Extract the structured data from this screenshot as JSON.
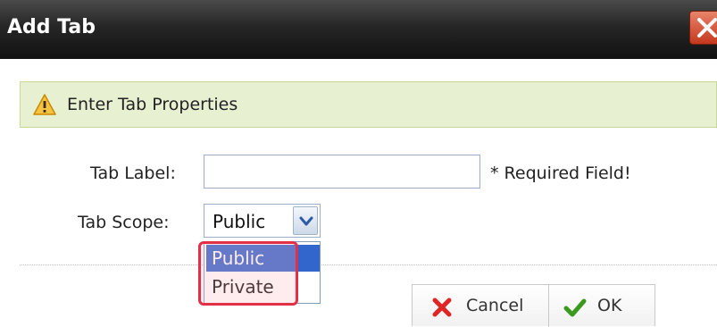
{
  "dialog": {
    "title": "Add Tab",
    "info_message": "Enter Tab Properties",
    "fields": {
      "tab_label": {
        "label": "Tab Label:",
        "value": "",
        "required_note": "* Required Field!"
      },
      "tab_scope": {
        "label": "Tab Scope:",
        "selected": "Public",
        "options": [
          "Public",
          "Private"
        ]
      }
    },
    "buttons": {
      "cancel": "Cancel",
      "ok": "OK"
    },
    "icons": {
      "close": "close-icon",
      "warning": "warning-icon",
      "dropdown": "chevron-down-icon",
      "cancel": "x-icon",
      "ok": "checkmark-icon"
    },
    "colors": {
      "title_bar": "#1b1b1b",
      "close_button": "#d9553a",
      "info_bar": "#e8f0d2",
      "selected_option": "#3366cc",
      "highlight_outline": "#e23049"
    }
  }
}
